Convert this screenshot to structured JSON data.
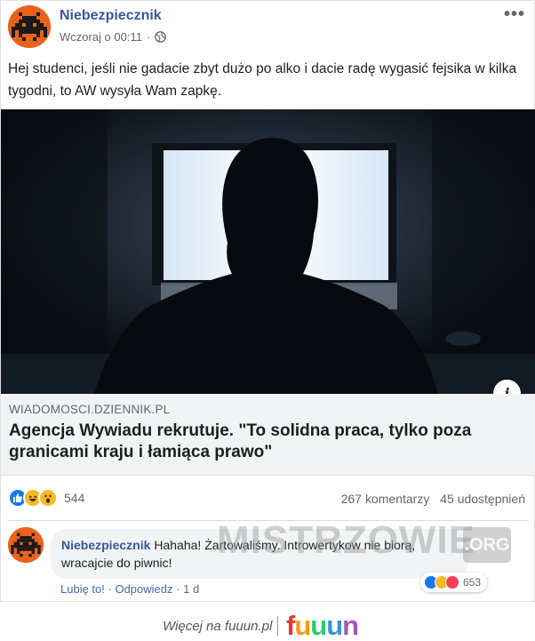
{
  "post": {
    "author": "Niebezpiecznik",
    "time": "Wczoraj o 00:11",
    "separator": "·",
    "more": "•••",
    "text": "Hej studenci, jeśli nie gadacie zbyt dużo po alko i dacie radę wygasić fejsika w kilka tygodni, to AW wysyła Wam zapkę."
  },
  "link": {
    "domain": "WIADOMOSCI.DZIENNIK.PL",
    "title": "Agencja Wywiadu rekrutuje. \"To solidna praca, tylko poza granicami kraju i łamiąca prawo\"",
    "info": "i"
  },
  "stats": {
    "reaction_count": "544",
    "comments": "267 komentarzy",
    "shares": "45 udostępnień",
    "reactions": [
      "like-icon",
      "haha-icon",
      "wow-icon"
    ]
  },
  "comment": {
    "author": "Niebezpiecznik",
    "text": "Hahaha! Żartowaliśmy. Introwertykow nie biorą, wracajcie do piwnic!",
    "like": "Lubię to!",
    "reply": "Odpowiedz",
    "time": "1 d",
    "sep": "·",
    "reaction_count": "653",
    "reactions": [
      "like-icon",
      "haha-icon",
      "love-icon"
    ]
  },
  "watermark": {
    "text": "MISTRZOWIE",
    "suffix": ".ORG"
  },
  "footer": {
    "text": "Więcej na fuuun.pl",
    "logo_letters": [
      "f",
      "u",
      "u",
      "u",
      "n"
    ],
    "logo_colors": [
      "#e63a2e",
      "#f39c12",
      "#2ecc71",
      "#3498db",
      "#9b59b6"
    ]
  },
  "colors": {
    "link_blue": "#385898",
    "accent": "#4267b2",
    "avatar": "#e9621c"
  }
}
